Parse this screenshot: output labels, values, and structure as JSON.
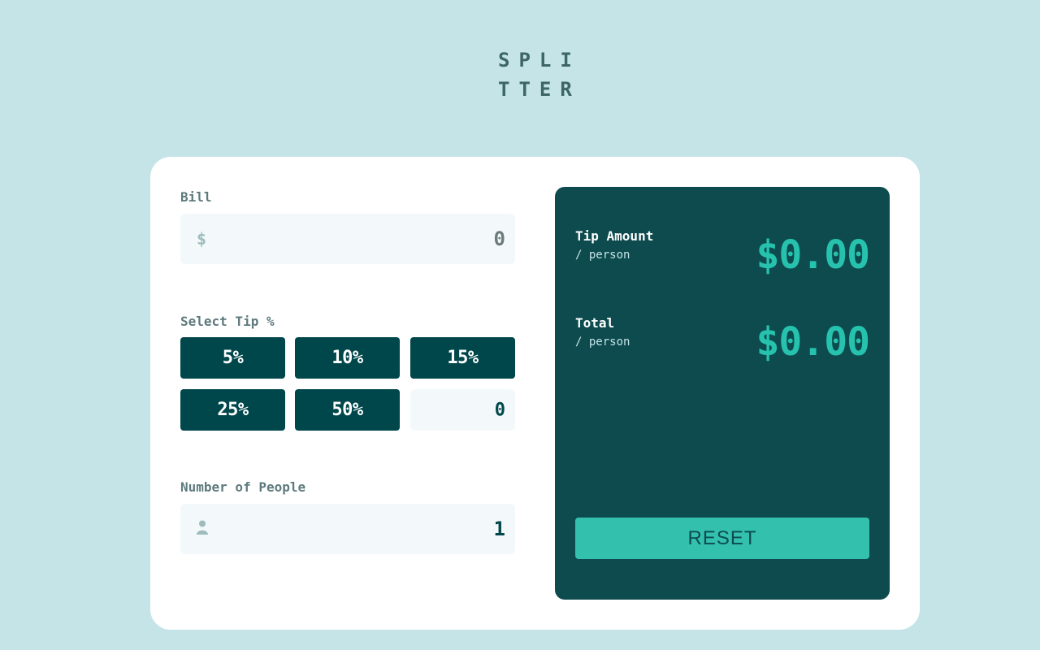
{
  "logo": {
    "line1": "SPLI",
    "line2": "TTER"
  },
  "bill": {
    "label": "Bill",
    "prefix": "$",
    "value": "0"
  },
  "tip": {
    "label": "Select Tip %",
    "options": [
      "5%",
      "10%",
      "15%",
      "25%",
      "50%"
    ],
    "custom_value": "0"
  },
  "people": {
    "label": "Number of People",
    "icon": "person-icon",
    "value": "1"
  },
  "results": {
    "tip_title": "Tip Amount",
    "tip_sub": "/ person",
    "tip_value": "$0.00",
    "total_title": "Total",
    "total_sub": "/ person",
    "total_value": "$0.00",
    "reset_label": "RESET"
  },
  "colors": {
    "background": "#c5e4e7",
    "dark_cyan": "#00474b",
    "accent": "#26c2ad",
    "input_bg": "#f3f9fa"
  }
}
